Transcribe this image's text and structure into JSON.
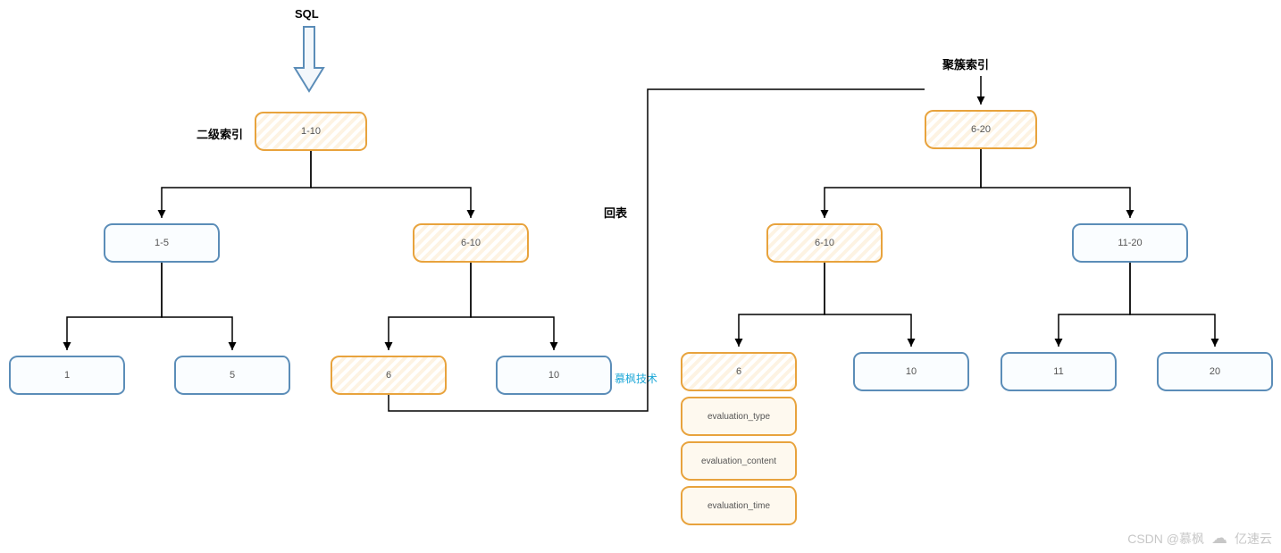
{
  "title_sql": "SQL",
  "left_tree_label": "二级索引",
  "right_tree_label": "聚簇索引",
  "link_label": "回表",
  "watermark_small": "慕枫技术",
  "watermark_author": "CSDN @慕枫",
  "watermark_site": "亿速云",
  "left_tree": {
    "root": "1-10",
    "l1_left": "1-5",
    "l1_right": "6-10",
    "leaves": [
      "1",
      "5",
      "6",
      "10"
    ]
  },
  "right_tree": {
    "root": "6-20",
    "l1_left": "6-10",
    "l1_right": "11-20",
    "leaves": [
      "6",
      "10",
      "11",
      "20"
    ]
  },
  "data_rows": [
    "evaluation_type",
    "evaluation_content",
    "evaluation_time"
  ],
  "colors": {
    "orange": "#e8a33d",
    "blue": "#5b8db8"
  }
}
